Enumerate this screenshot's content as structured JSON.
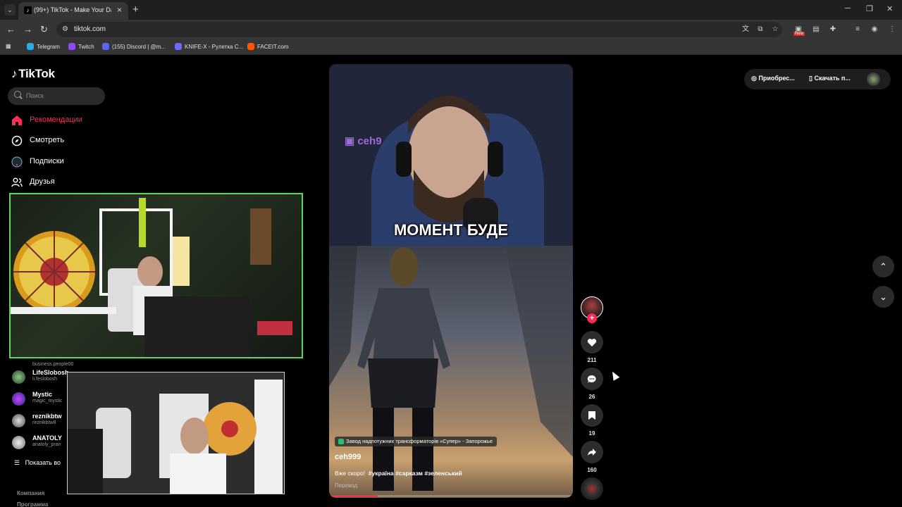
{
  "browser": {
    "tab_title": "(99+) TikTok - Make Your Da",
    "url": "tiktok.com",
    "bookmarks": [
      {
        "label": "Telegram",
        "icon": "telegram-icon",
        "color": "#2aabee"
      },
      {
        "label": "Twitch",
        "icon": "twitch-icon",
        "color": "#9146ff"
      },
      {
        "label": "(155) Discord | @m...",
        "icon": "discord-icon",
        "color": "#5865f2"
      },
      {
        "label": "KNIFE-X - Рулетка С...",
        "icon": "knifex-icon",
        "color": "#6a6aff"
      },
      {
        "label": "FACEIT.com",
        "icon": "faceit-icon",
        "color": "#ff5500"
      }
    ],
    "extension_badge": "New"
  },
  "tiktok": {
    "logo_text": "TikTok",
    "search_placeholder": "Поиск",
    "nav": [
      {
        "label": "Рекомендации",
        "icon": "home-icon",
        "active": true
      },
      {
        "label": "Смотреть",
        "icon": "compass-icon",
        "active": false
      },
      {
        "label": "Подписки",
        "icon": "following-icon",
        "active": false
      },
      {
        "label": "Друзья",
        "icon": "friends-icon",
        "active": false
      }
    ],
    "followed_accounts": [
      {
        "name": "",
        "handle": "business.people00"
      },
      {
        "name": "LifeSlobosh",
        "handle": "li.feslobosh"
      },
      {
        "name": "Mystic",
        "handle": "magic_mystic"
      },
      {
        "name": "reznikbtw",
        "handle": "reznikbtw8"
      },
      {
        "name": "ANATOLY",
        "handle": "anatoly_pran"
      }
    ],
    "show_more": "Показать во",
    "footer": [
      "Компания",
      "Программа"
    ],
    "accent_color": "#fe2c55"
  },
  "video": {
    "watermark": "ceh9",
    "caption": "МОМЕНТ БУДЕ",
    "location": "Завод надпотужних трансформаторів «Супер» - Запорожье",
    "author": "ceh999",
    "description": "Вже скоро!",
    "hashtags": [
      "#україна",
      "#сарказм",
      "#зеленський"
    ],
    "translate": "Перевод",
    "progress_fraction": 0.2
  },
  "actions": {
    "likes": "211",
    "comments": "26",
    "saves": "19",
    "shares": "160"
  },
  "top_right": {
    "get_coins": "Приобрес...",
    "download_app": "Скачать п..."
  }
}
